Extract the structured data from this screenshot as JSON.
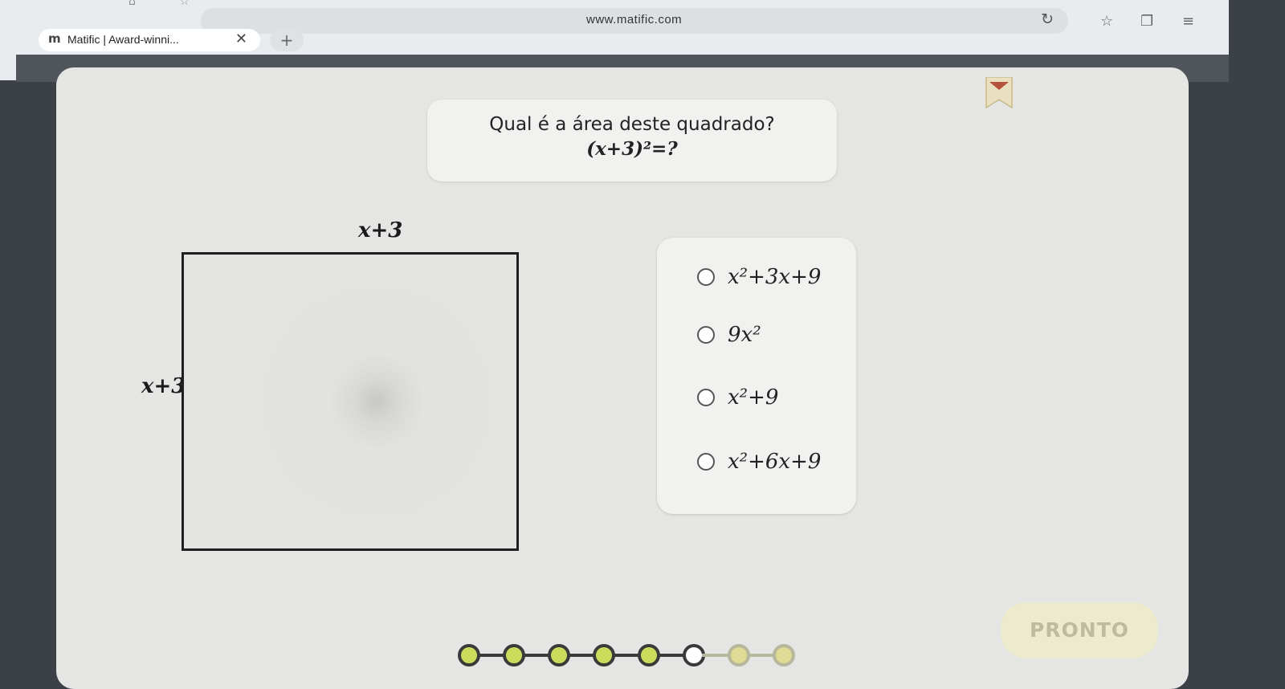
{
  "browser": {
    "url": "www.matific.com",
    "tab": {
      "favicon": "m",
      "title": "Matific | Award-winni...",
      "close": "✕"
    },
    "newtab": "+",
    "icons": [
      "reload-icon",
      "star-icon",
      "tabs-icon",
      "menu-icon"
    ]
  },
  "question": {
    "text": "Qual é a área deste quadrado?",
    "expression": "(x+3)²=?"
  },
  "figure": {
    "top_label": "x+3",
    "side_label": "x+3"
  },
  "options": [
    {
      "label": "x²+3x+9"
    },
    {
      "label": "9x²"
    },
    {
      "label": "x²+9"
    },
    {
      "label": "x²+6x+9"
    }
  ],
  "submit_label": "PRONTO",
  "progress": {
    "total": 8,
    "completed": 5,
    "current": 6
  },
  "colors": {
    "completed_dot": "#c9dd5a",
    "current_dot": "#ffffff",
    "future_dot": "#dedb94",
    "button_disabled": "#ecebcd"
  }
}
